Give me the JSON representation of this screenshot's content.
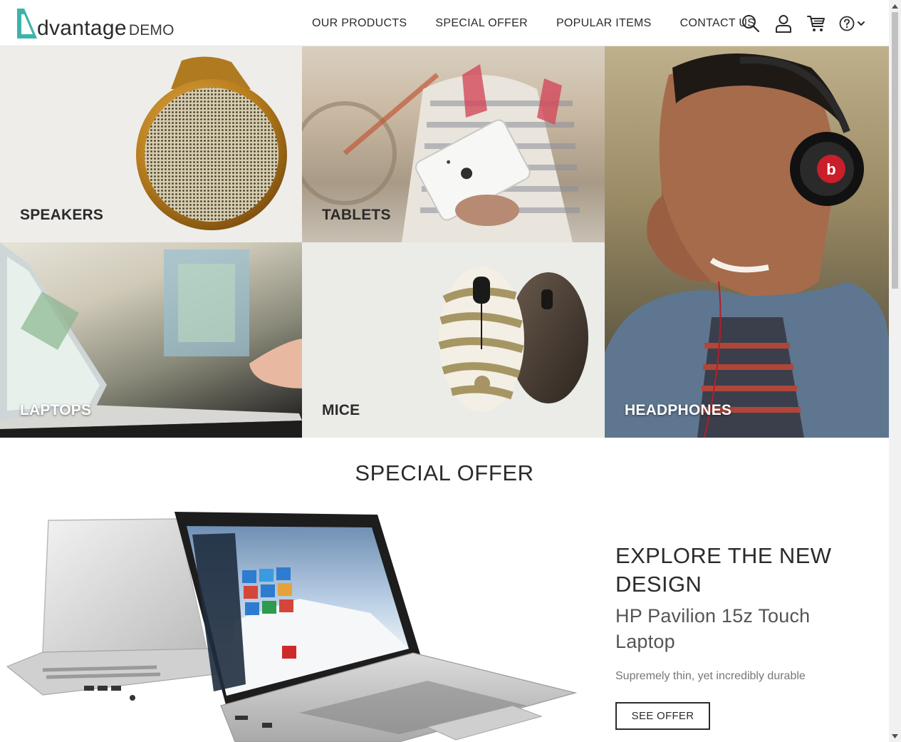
{
  "brand": {
    "name": "dvantage",
    "sub": "DEMO",
    "accent": "#3cb3ab"
  },
  "nav": {
    "items": [
      {
        "label": "OUR PRODUCTS"
      },
      {
        "label": "SPECIAL OFFER"
      },
      {
        "label": "POPULAR ITEMS"
      },
      {
        "label": "CONTACT US"
      }
    ]
  },
  "header_icons": [
    "search-icon",
    "user-icon",
    "cart-icon",
    "help-icon",
    "chevron-down-icon"
  ],
  "categories": [
    {
      "label": "SPEAKERS"
    },
    {
      "label": "TABLETS"
    },
    {
      "label": "LAPTOPS"
    },
    {
      "label": "MICE"
    },
    {
      "label": "HEADPHONES"
    }
  ],
  "special_offer": {
    "title": "SPECIAL OFFER",
    "headline": "EXPLORE THE NEW DESIGN",
    "product": "HP Pavilion 15z Touch Laptop",
    "description": "Supremely thin, yet incredibly durable",
    "button_label": "SEE OFFER"
  },
  "colors": {
    "text": "#2b2b2b",
    "muted": "#777777",
    "scrollbar_track": "#f1f1f1",
    "scrollbar_thumb": "#c1c1c1"
  }
}
